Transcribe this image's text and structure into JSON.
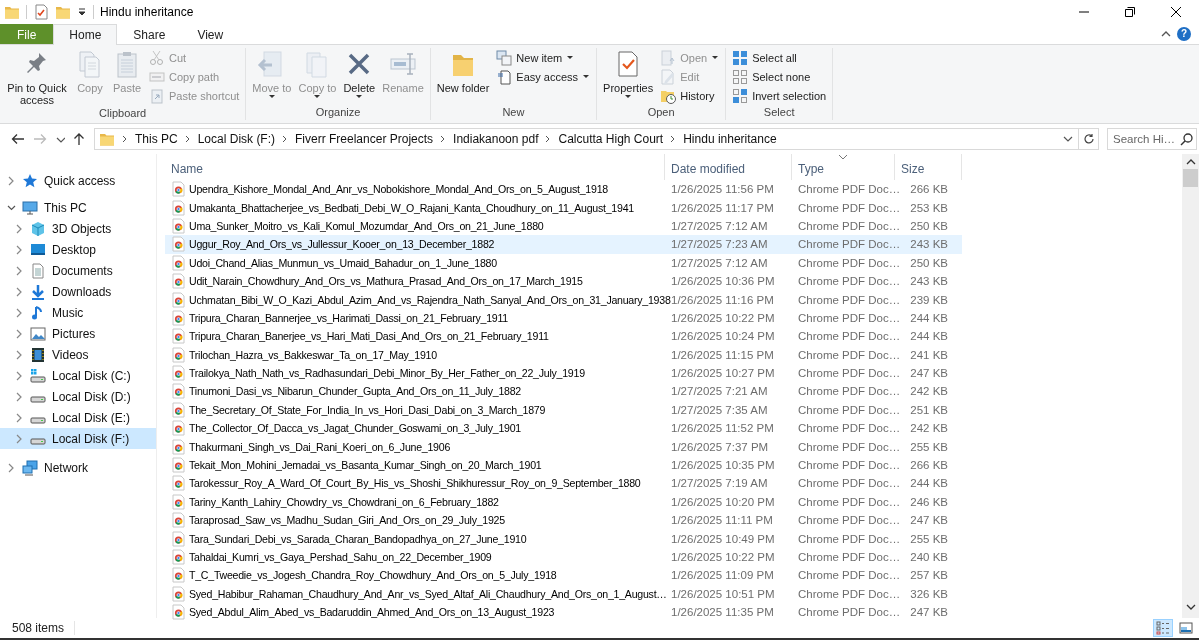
{
  "window": {
    "title": "Hindu inheritance"
  },
  "ribbon": {
    "tabs": [
      {
        "label": "File",
        "kind": "file",
        "selected": false
      },
      {
        "label": "Home",
        "kind": "tab",
        "selected": true
      },
      {
        "label": "Share",
        "kind": "tab",
        "selected": false
      },
      {
        "label": "View",
        "kind": "tab",
        "selected": false
      }
    ],
    "help_button": "?",
    "groups": [
      {
        "label": "Clipboard",
        "commands": [
          {
            "label": "Pin to Quick access",
            "kind": "large",
            "disabled": false,
            "dropdown": false
          },
          {
            "label": "Copy",
            "kind": "large",
            "disabled": true,
            "dropdown": false
          },
          {
            "label": "Paste",
            "kind": "large",
            "disabled": true,
            "dropdown": false
          },
          {
            "label": "Cut",
            "kind": "small",
            "disabled": true,
            "dropdown": false
          },
          {
            "label": "Copy path",
            "kind": "small",
            "disabled": true,
            "dropdown": false
          },
          {
            "label": "Paste shortcut",
            "kind": "small",
            "disabled": true,
            "dropdown": false
          }
        ]
      },
      {
        "label": "Organize",
        "commands": [
          {
            "label": "Move to",
            "kind": "large",
            "disabled": true,
            "dropdown": true
          },
          {
            "label": "Copy to",
            "kind": "large",
            "disabled": true,
            "dropdown": true
          },
          {
            "label": "Delete",
            "kind": "large",
            "disabled": false,
            "dropdown": true
          },
          {
            "label": "Rename",
            "kind": "large",
            "disabled": true,
            "dropdown": false
          }
        ]
      },
      {
        "label": "New",
        "commands": [
          {
            "label": "New folder",
            "kind": "large",
            "disabled": false,
            "dropdown": false
          },
          {
            "label": "New item",
            "kind": "small",
            "disabled": false,
            "dropdown": true
          },
          {
            "label": "Easy access",
            "kind": "small",
            "disabled": false,
            "dropdown": true
          }
        ]
      },
      {
        "label": "Open",
        "commands": [
          {
            "label": "Properties",
            "kind": "large",
            "disabled": false,
            "dropdown": true
          },
          {
            "label": "Open",
            "kind": "small",
            "disabled": true,
            "dropdown": true
          },
          {
            "label": "Edit",
            "kind": "small",
            "disabled": true,
            "dropdown": false
          },
          {
            "label": "History",
            "kind": "small",
            "disabled": false,
            "dropdown": false
          }
        ]
      },
      {
        "label": "Select",
        "commands": [
          {
            "label": "Select all",
            "kind": "small",
            "disabled": false,
            "dropdown": false
          },
          {
            "label": "Select none",
            "kind": "small",
            "disabled": false,
            "dropdown": false
          },
          {
            "label": "Invert selection",
            "kind": "small",
            "disabled": false,
            "dropdown": false
          }
        ]
      }
    ]
  },
  "address_bar": {
    "path": [
      "This PC",
      "Local Disk (F:)",
      "Fiverr Freelancer Projects",
      "Indiakanoon pdf",
      "Calcutta High Court",
      "Hindu inheritance"
    ],
    "search_placeholder": "Search Hi…"
  },
  "navigation": [
    {
      "label": "Quick access",
      "expanded": false,
      "selected": false
    },
    {
      "label": "This PC",
      "expanded": true,
      "selected": false,
      "children": [
        {
          "label": "3D Objects",
          "expanded": false,
          "selected": false
        },
        {
          "label": "Desktop",
          "expanded": false,
          "selected": false
        },
        {
          "label": "Documents",
          "expanded": false,
          "selected": false
        },
        {
          "label": "Downloads",
          "expanded": false,
          "selected": false
        },
        {
          "label": "Music",
          "expanded": false,
          "selected": false
        },
        {
          "label": "Pictures",
          "expanded": false,
          "selected": false
        },
        {
          "label": "Videos",
          "expanded": false,
          "selected": false
        },
        {
          "label": "Local Disk (C:)",
          "expanded": false,
          "selected": false
        },
        {
          "label": "Local Disk (D:)",
          "expanded": false,
          "selected": false
        },
        {
          "label": "Local Disk (E:)",
          "expanded": false,
          "selected": false
        },
        {
          "label": "Local Disk (F:)",
          "expanded": false,
          "selected": true
        }
      ]
    },
    {
      "label": "Network",
      "expanded": false,
      "selected": false
    }
  ],
  "file_list": {
    "columns": [
      {
        "label": "Name"
      },
      {
        "label": "Date modified"
      },
      {
        "label": "Type",
        "sorted": true
      },
      {
        "label": "Size"
      }
    ],
    "files": [
      {
        "name": "Upendra_Kishore_Mondal_And_Anr_vs_Nobokishore_Mondal_And_Ors_on_5_August_1918",
        "date_modified": "1/26/2025 11:56 PM",
        "type": "Chrome PDF Doc…",
        "size": "266 KB",
        "highlighted": false
      },
      {
        "name": "Umakanta_Bhattacherjee_vs_Bedbati_Debi_W_O_Rajani_Kanta_Choudhury_on_11_August_1941",
        "date_modified": "1/26/2025 11:17 PM",
        "type": "Chrome PDF Doc…",
        "size": "253 KB",
        "highlighted": false
      },
      {
        "name": "Uma_Sunker_Moitro_vs_Kali_Komul_Mozumdar_And_Ors_on_21_June_1880",
        "date_modified": "1/27/2025 7:12 AM",
        "type": "Chrome PDF Doc…",
        "size": "250 KB",
        "highlighted": false
      },
      {
        "name": "Uggur_Roy_And_Ors_vs_Jullessur_Kooer_on_13_December_1882",
        "date_modified": "1/27/2025 7:23 AM",
        "type": "Chrome PDF Doc…",
        "size": "243 KB",
        "highlighted": true
      },
      {
        "name": "Udoi_Chand_Alias_Munmun_vs_Umaid_Bahadur_on_1_June_1880",
        "date_modified": "1/27/2025 7:12 AM",
        "type": "Chrome PDF Doc…",
        "size": "250 KB",
        "highlighted": false
      },
      {
        "name": "Udit_Narain_Chowdhury_And_Ors_vs_Mathura_Prasad_And_Ors_on_17_March_1915",
        "date_modified": "1/26/2025 10:36 PM",
        "type": "Chrome PDF Doc…",
        "size": "243 KB",
        "highlighted": false
      },
      {
        "name": "Uchmatan_Bibi_W_O_Kazi_Abdul_Azim_And_vs_Rajendra_Nath_Sanyal_And_Ors_on_31_January_1938",
        "date_modified": "1/26/2025 11:16 PM",
        "type": "Chrome PDF Doc…",
        "size": "239 KB",
        "highlighted": false
      },
      {
        "name": "Tripura_Charan_Bannerjee_vs_Harimati_Dassi_on_21_February_1911",
        "date_modified": "1/26/2025 10:22 PM",
        "type": "Chrome PDF Doc…",
        "size": "244 KB",
        "highlighted": false
      },
      {
        "name": "Tripura_Charan_Banerjee_vs_Hari_Mati_Dasi_And_Ors_on_21_February_1911",
        "date_modified": "1/26/2025 10:24 PM",
        "type": "Chrome PDF Doc…",
        "size": "244 KB",
        "highlighted": false
      },
      {
        "name": "Trilochan_Hazra_vs_Bakkeswar_Ta_on_17_May_1910",
        "date_modified": "1/26/2025 11:15 PM",
        "type": "Chrome PDF Doc…",
        "size": "241 KB",
        "highlighted": false
      },
      {
        "name": "Trailokya_Nath_Nath_vs_Radhasundari_Debi_Minor_By_Her_Father_on_22_July_1919",
        "date_modified": "1/26/2025 10:27 PM",
        "type": "Chrome PDF Doc…",
        "size": "247 KB",
        "highlighted": false
      },
      {
        "name": "Tinumoni_Dasi_vs_Nibarun_Chunder_Gupta_And_Ors_on_11_July_1882",
        "date_modified": "1/27/2025 7:21 AM",
        "type": "Chrome PDF Doc…",
        "size": "242 KB",
        "highlighted": false
      },
      {
        "name": "The_Secretary_Of_State_For_India_In_vs_Hori_Dasi_Dabi_on_3_March_1879",
        "date_modified": "1/27/2025 7:35 AM",
        "type": "Chrome PDF Doc…",
        "size": "251 KB",
        "highlighted": false
      },
      {
        "name": "The_Collector_Of_Dacca_vs_Jagat_Chunder_Goswami_on_3_July_1901",
        "date_modified": "1/26/2025 11:52 PM",
        "type": "Chrome PDF Doc…",
        "size": "242 KB",
        "highlighted": false
      },
      {
        "name": "Thakurmani_Singh_vs_Dai_Rani_Koeri_on_6_June_1906",
        "date_modified": "1/26/2025 7:37 PM",
        "type": "Chrome PDF Doc…",
        "size": "255 KB",
        "highlighted": false
      },
      {
        "name": "Tekait_Mon_Mohini_Jemadai_vs_Basanta_Kumar_Singh_on_20_March_1901",
        "date_modified": "1/26/2025 10:35 PM",
        "type": "Chrome PDF Doc…",
        "size": "266 KB",
        "highlighted": false
      },
      {
        "name": "Tarokessur_Roy_A_Ward_Of_Court_By_His_vs_Shoshi_Shikhuressur_Roy_on_9_September_1880",
        "date_modified": "1/27/2025 7:19 AM",
        "type": "Chrome PDF Doc…",
        "size": "244 KB",
        "highlighted": false
      },
      {
        "name": "Tariny_Kanth_Lahiry_Chowdry_vs_Chowdrani_on_6_February_1882",
        "date_modified": "1/26/2025 10:20 PM",
        "type": "Chrome PDF Doc…",
        "size": "246 KB",
        "highlighted": false
      },
      {
        "name": "Taraprosad_Saw_vs_Madhu_Sudan_Giri_And_Ors_on_29_July_1925",
        "date_modified": "1/26/2025 11:11 PM",
        "type": "Chrome PDF Doc…",
        "size": "247 KB",
        "highlighted": false
      },
      {
        "name": "Tara_Sundari_Debi_vs_Sarada_Charan_Bandopadhya_on_27_June_1910",
        "date_modified": "1/26/2025 10:49 PM",
        "type": "Chrome PDF Doc…",
        "size": "255 KB",
        "highlighted": false
      },
      {
        "name": "Tahaldai_Kumri_vs_Gaya_Pershad_Sahu_on_22_December_1909",
        "date_modified": "1/26/2025 10:22 PM",
        "type": "Chrome PDF Doc…",
        "size": "240 KB",
        "highlighted": false
      },
      {
        "name": "T_C_Tweedie_vs_Jogesh_Chandra_Roy_Chowdhury_And_Ors_on_5_July_1918",
        "date_modified": "1/26/2025 11:09 PM",
        "type": "Chrome PDF Doc…",
        "size": "257 KB",
        "highlighted": false
      },
      {
        "name": "Syed_Habibur_Rahaman_Chaudhury_And_Anr_vs_Syed_Altaf_Ali_Chaudhury_And_Ors_on_1_August…",
        "date_modified": "1/26/2025 10:51 PM",
        "type": "Chrome PDF Doc…",
        "size": "326 KB",
        "highlighted": false
      },
      {
        "name": "Syed_Abdul_Alim_Abed_vs_Badaruddin_Ahmed_And_Ors_on_13_August_1923",
        "date_modified": "1/26/2025 11:35 PM",
        "type": "Chrome PDF Doc…",
        "size": "247 KB",
        "highlighted": false
      }
    ]
  },
  "status_bar": {
    "item_count": "508 items",
    "views": [
      {
        "kind": "details",
        "selected": true
      },
      {
        "kind": "large_icons",
        "selected": false
      }
    ]
  }
}
